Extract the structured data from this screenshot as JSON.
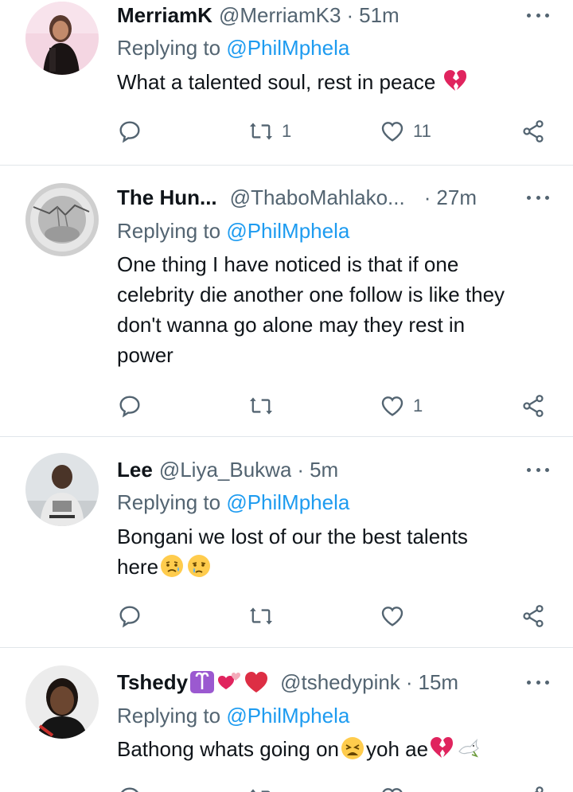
{
  "colors": {
    "text": "#0f1419",
    "muted": "#536471",
    "link": "#1d9bf0",
    "divider": "#e1e6ea"
  },
  "tweets": [
    {
      "name": "MerriamK",
      "handle": "@MerriamK3",
      "separator": "·",
      "time": "51m",
      "reply_prefix": "Replying to",
      "reply_handle": "@PhilMphela",
      "text": "What a talented soul, rest in peace",
      "emojis": [
        "broken-heart"
      ],
      "reply_count": "",
      "retweet_count": "1",
      "like_count": "11"
    },
    {
      "name": "The Hun...",
      "handle": "@ThaboMahlako...",
      "separator": "·",
      "time": "27m",
      "reply_prefix": "Replying to",
      "reply_handle": "@PhilMphela",
      "text_lines": [
        "One thing I have noticed is that if one",
        "celebrity die another one follow is like they",
        "don't wanna go alone may they rest in",
        "power"
      ],
      "reply_count": "",
      "retweet_count": "",
      "like_count": "1"
    },
    {
      "name": "Lee",
      "handle": "@Liya_Bukwa",
      "separator": "·",
      "time": "5m",
      "reply_prefix": "Replying to",
      "reply_handle": "@PhilMphela",
      "text_line1": "Bongani we lost of our the best talents",
      "text_line2": "here",
      "emojis": [
        "sad-relieved-face",
        "crying-face"
      ],
      "reply_count": "",
      "retweet_count": "",
      "like_count": ""
    },
    {
      "name": "Tshedy",
      "name_emojis": [
        "aries-symbol",
        "revolving-hearts",
        "red-heart"
      ],
      "handle": "@tshedypink",
      "separator": "·",
      "time": "15m",
      "reply_prefix": "Replying to",
      "reply_handle": "@PhilMphela",
      "text_part1": "Bathong whats going on",
      "text_part2": "yoh ae",
      "emojis": [
        "tired-face",
        "broken-heart",
        "dove"
      ]
    }
  ]
}
